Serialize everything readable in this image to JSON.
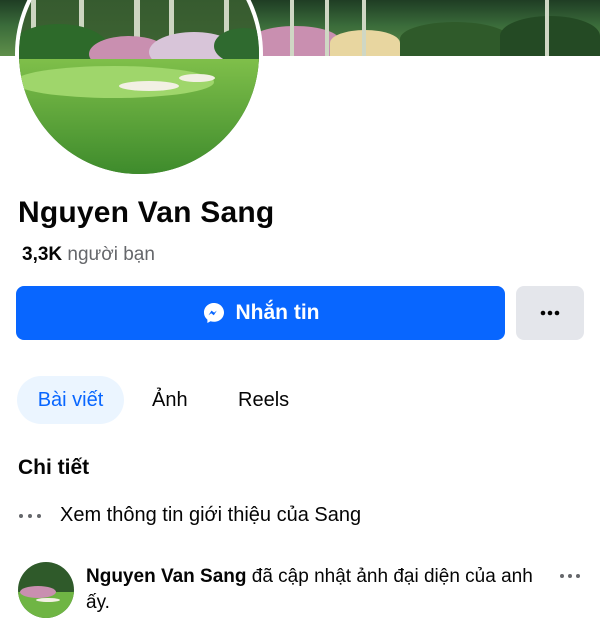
{
  "profile": {
    "name": "Nguyen Van Sang",
    "friends_count": "3,3K",
    "friends_label": "người bạn"
  },
  "actions": {
    "message_label": "Nhắn tin",
    "message_icon": "messenger-icon",
    "more_icon": "more-horizontal-icon"
  },
  "tabs": [
    {
      "label": "Bài viết",
      "active": true
    },
    {
      "label": "Ảnh",
      "active": false
    },
    {
      "label": "Reels",
      "active": false
    }
  ],
  "details": {
    "title": "Chi tiết",
    "intro_label": "Xem thông tin giới thiệu của Sang",
    "intro_icon": "more-horizontal-icon"
  },
  "post": {
    "author": "Nguyen Van Sang",
    "action_text": "đã cập nhật ảnh đại diện của anh ấy.",
    "more_icon": "more-horizontal-icon"
  },
  "colors": {
    "accent": "#0866ff",
    "active_tab_bg": "#ebf5ff",
    "secondary_button": "#e4e6eb",
    "secondary_text": "#65676b"
  }
}
